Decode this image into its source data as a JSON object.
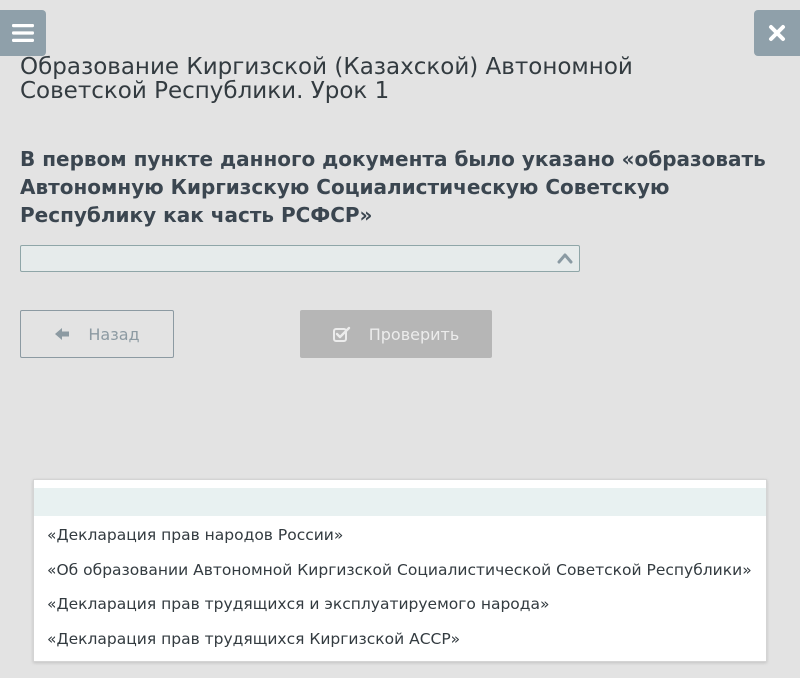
{
  "header": {
    "title": "Образование Киргизской (Казахской) Автономной Советской Республики. Урок 1"
  },
  "question": {
    "text": "В первом пункте данного документа было указано «образовать Автономную Киргизскую Социалистическую Советскую Республику как часть РСФСР»"
  },
  "select": {
    "value": ""
  },
  "buttons": {
    "back_label": "Назад",
    "check_label": "Проверить"
  },
  "dropdown": {
    "options": [
      "«Декларация прав народов России»",
      "«Об образовании Автономной Киргизской Социалистической Советской Республики»",
      "«Декларация прав трудящихся и эксплуатируемого народа»",
      "«Декларация прав трудящихся Киргизской АССР»"
    ]
  },
  "colors": {
    "background": "#e3e3e3",
    "side_button": "#8fa0aa",
    "disabled_button": "#b6b6b6",
    "highlight_row": "#e8f1f1"
  }
}
